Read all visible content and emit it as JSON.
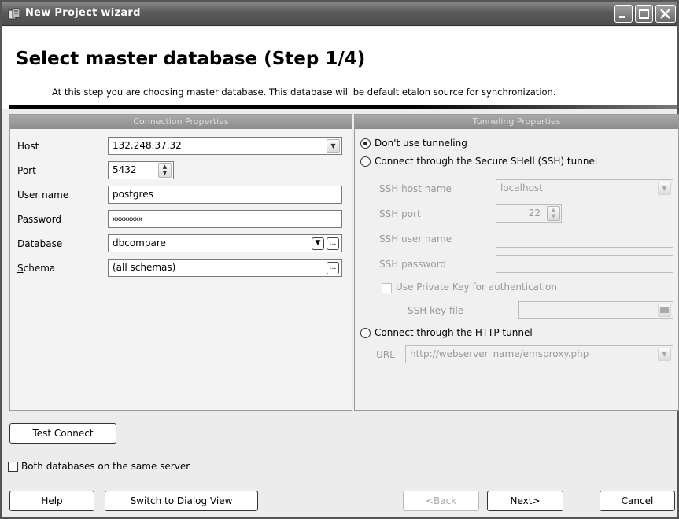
{
  "window": {
    "title": "New Project wizard",
    "controls": {
      "minimize": "minimize-icon",
      "maximize": "maximize-icon",
      "close": "close-icon"
    }
  },
  "header": {
    "title": "Select master database (Step 1/4)",
    "description": "At this step you are choosing master database. This database will be default etalon source for synchronization."
  },
  "connection": {
    "panel_title": "Connection Properties",
    "host_label": "Host",
    "host_value": "132.248.37.32",
    "port_label": "Port",
    "port_value": "5432",
    "user_label": "User name",
    "user_value": "postgres",
    "password_label": "Password",
    "password_value": "xxxxxxxx",
    "database_label": "Database",
    "database_value": "dbcompare",
    "schema_label": "Schema",
    "schema_value": "(all schemas)"
  },
  "tunneling": {
    "panel_title": "Tunneling Properties",
    "opt_none": "Don't use tunneling",
    "opt_ssh": "Connect through the Secure SHell (SSH) tunnel",
    "ssh_host_label": "SSH host name",
    "ssh_host_value": "localhost",
    "ssh_port_label": "SSH port",
    "ssh_port_value": "22",
    "ssh_user_label": "SSH user name",
    "ssh_password_label": "SSH password",
    "private_key_label": "Use Private Key for authentication",
    "ssh_key_label": "SSH key file",
    "opt_http": "Connect through the HTTP tunnel",
    "url_label": "URL",
    "url_value": "http://webserver_name/emsproxy.php",
    "selected": "opt_none"
  },
  "footer": {
    "test_connect": "Test Connect",
    "same_server": "Both databases on the same server",
    "help": "Help",
    "switch_view": "Switch to Dialog View",
    "back": "<Back",
    "next": "Next>",
    "cancel": "Cancel"
  },
  "colors": {
    "title_bar": "#5a5a5a",
    "panel_header": "#9a9a9a",
    "disabled_text": "#9a9a9a"
  }
}
